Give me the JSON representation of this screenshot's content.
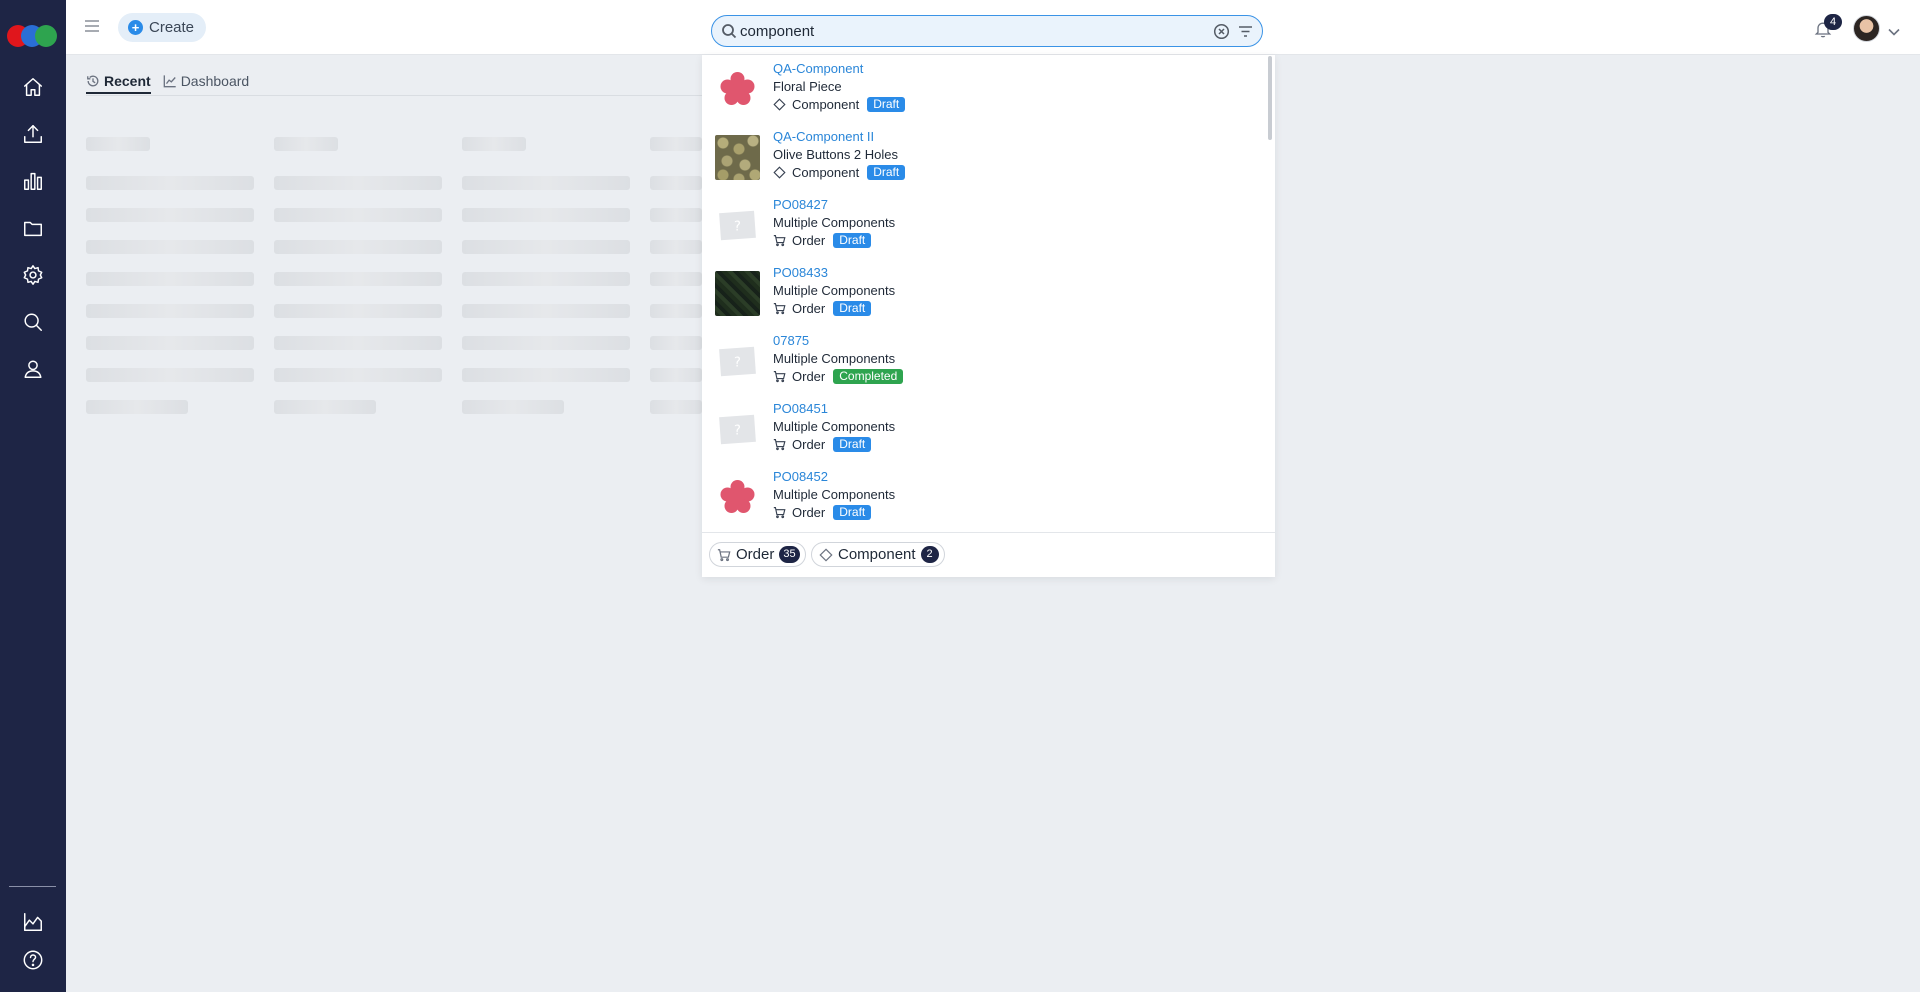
{
  "header": {
    "create_label": "Create",
    "search": {
      "value": "component",
      "placeholder": ""
    },
    "notification_count": "4"
  },
  "sidebar": {
    "items": [
      {
        "icon": "home-icon"
      },
      {
        "icon": "upload-icon"
      },
      {
        "icon": "bar-chart-icon"
      },
      {
        "icon": "folder-icon"
      },
      {
        "icon": "gear-icon"
      },
      {
        "icon": "search-icon"
      },
      {
        "icon": "user-icon"
      },
      {
        "icon": "area-chart-icon"
      },
      {
        "icon": "help-icon"
      }
    ]
  },
  "tabs": [
    {
      "label": "Recent",
      "icon": "history-icon",
      "active": true
    },
    {
      "label": "Dashboard",
      "icon": "chart-icon",
      "active": false
    }
  ],
  "results": [
    {
      "title": "QA-Component",
      "subtitle": "Floral Piece",
      "type": "Component",
      "type_icon": "diamond-icon",
      "status": "Draft",
      "thumb": "flower"
    },
    {
      "title": "QA-Component II",
      "subtitle": "Olive Buttons 2 Holes",
      "type": "Component",
      "type_icon": "diamond-icon",
      "status": "Draft",
      "thumb": "buttons"
    },
    {
      "title": "PO08427",
      "subtitle": "Multiple Components",
      "type": "Order",
      "type_icon": "cart-icon",
      "status": "Draft",
      "thumb": "placeholder"
    },
    {
      "title": "PO08433",
      "subtitle": "Multiple Components",
      "type": "Order",
      "type_icon": "cart-icon",
      "status": "Draft",
      "thumb": "leaves"
    },
    {
      "title": "07875",
      "subtitle": "Multiple Components",
      "type": "Order",
      "type_icon": "cart-icon",
      "status": "Completed",
      "thumb": "placeholder"
    },
    {
      "title": "PO08451",
      "subtitle": "Multiple Components",
      "type": "Order",
      "type_icon": "cart-icon",
      "status": "Draft",
      "thumb": "placeholder"
    },
    {
      "title": "PO08452",
      "subtitle": "Multiple Components",
      "type": "Order",
      "type_icon": "cart-icon",
      "status": "Draft",
      "thumb": "flower"
    }
  ],
  "filters": [
    {
      "label": "Order",
      "count": "35",
      "icon": "cart-icon"
    },
    {
      "label": "Component",
      "count": "2",
      "icon": "diamond-icon"
    }
  ],
  "colors": {
    "sidebar_bg": "#1e2545",
    "link": "#2a86d8",
    "draft_badge": "#2a8be8",
    "completed_badge": "#2ea44f",
    "page_bg": "#ebeef2"
  }
}
